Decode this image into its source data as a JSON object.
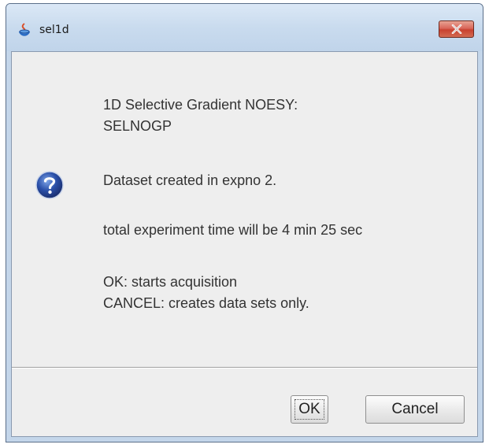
{
  "window": {
    "title": "sel1d"
  },
  "message": {
    "line1": "1D Selective Gradient NOESY:",
    "line2": "SELNOGP",
    "line3": "Dataset created in expno 2.",
    "line4": "total experiment time will be 4 min 25 sec",
    "line5": "OK: starts acquisition",
    "line6": "CANCEL: creates data sets only."
  },
  "buttons": {
    "ok_label": "OK",
    "cancel_label": "Cancel"
  },
  "icons": {
    "app": "java-app-icon",
    "dialog": "question-icon",
    "close": "close-icon"
  },
  "colors": {
    "title_bar": "#c4d6ea",
    "close_button": "#d9665a",
    "question_icon": "#2a4fa8",
    "client_bg": "#eeeeee"
  }
}
